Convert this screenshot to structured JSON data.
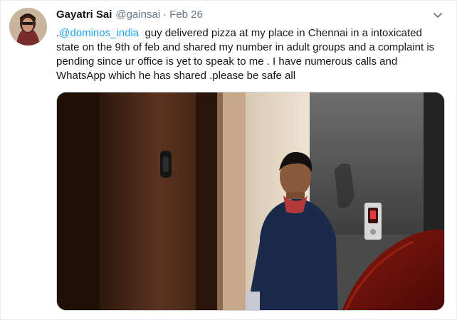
{
  "tweet": {
    "display_name": "Gayatri Sai",
    "handle": "@gainsai",
    "separator": "·",
    "date": "Feb 26",
    "text_prefix": ".",
    "mention": "@dominos_india",
    "text_body": "  guy delivered pizza at my place in Chennai in a intoxicated state on the 9th of feb and shared my number in adult groups and a complaint is pending since ur office is yet to speak to me . I have numerous calls and WhatsApp which he has shared .please be safe all"
  },
  "icons": {
    "avatar": "avatar-photo",
    "menu": "chevron-down-icon"
  },
  "colors": {
    "link": "#1da1f2",
    "text": "#14171a",
    "muted": "#657786"
  }
}
